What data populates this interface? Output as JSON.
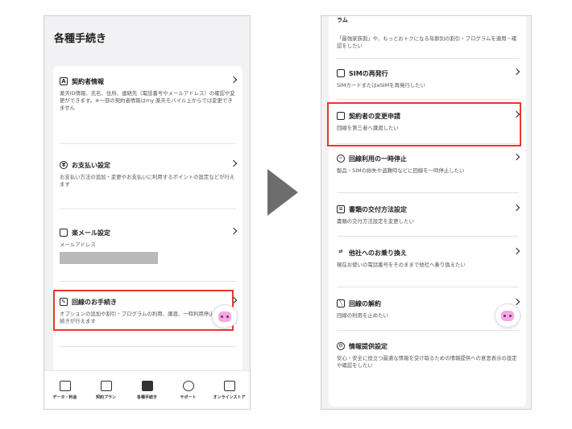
{
  "left": {
    "title": "各種手続き",
    "sections": [
      {
        "icon": "account-card-icon",
        "label": "契約者情報",
        "desc": "楽天ID情報、氏名、住所、連絡先（電話番号やメールアドレス）の確認や変更ができます。※一部の契約者情報はmy 楽天モバイル上からでは変更できません"
      },
      {
        "icon": "yen-icon",
        "label": "お支払い設定",
        "desc": "お支払い方法の追加・変更やお支払いに利用するポイントの設定などが行えます"
      },
      {
        "icon": "mail-icon",
        "label": "楽メール設定",
        "desc": "メールアドレス"
      },
      {
        "icon": "edit-icon",
        "label": "回線のお手続き",
        "desc": "オプションの追加や割引・プログラムの利用、譲渡、一時利用停止などの手続きが行えます"
      }
    ],
    "tabs": [
      {
        "icon": "fee-icon",
        "label": "データ・料金"
      },
      {
        "icon": "plan-icon",
        "label": "契約プラン"
      },
      {
        "icon": "procedure-icon",
        "label": "各種手続き"
      },
      {
        "icon": "support-icon",
        "label": "サポート"
      },
      {
        "icon": "store-icon",
        "label": "オンラインストア"
      }
    ]
  },
  "right": {
    "top_heading": "ラム",
    "top_desc": "「最強家族割」や、もっとおトクになる年齢別の割引・プログラムを適用・確認をしたい",
    "sections": [
      {
        "icon": "sim-icon",
        "label": "SIMの再発行",
        "desc": "SIMカードまたはeSIMを再発行したい"
      },
      {
        "icon": "contract-card-icon",
        "label": "契約者の変更申請",
        "desc": "回線を第三者へ譲渡したい"
      },
      {
        "icon": "minus-circle-icon",
        "label": "回線利用の一時停止",
        "desc": "製品・SIMの紛失や盗難時などに回線を一時停止したい"
      },
      {
        "icon": "document-icon",
        "label": "書類の交付方法設定",
        "desc": "書類の交付方法設定を変更したい"
      },
      {
        "icon": "transfer-icon",
        "label": "他社へのお乗り換え",
        "desc": "現在お使いの電話番号をそのままで他社へ乗り換えたい"
      },
      {
        "icon": "cancel-icon",
        "label": "回線の解約",
        "desc": "回線の利用を止めたい"
      },
      {
        "icon": "gear-icon",
        "label": "情報提供設定",
        "desc": "安心・安全に役立つ最適な情報を受け取るための情報提供への意思表示の設定や確認をしたい"
      }
    ]
  },
  "colors": {
    "highlight": "#e8392e",
    "arrow": "#6d6d6d",
    "background": "#f2f2f4"
  }
}
